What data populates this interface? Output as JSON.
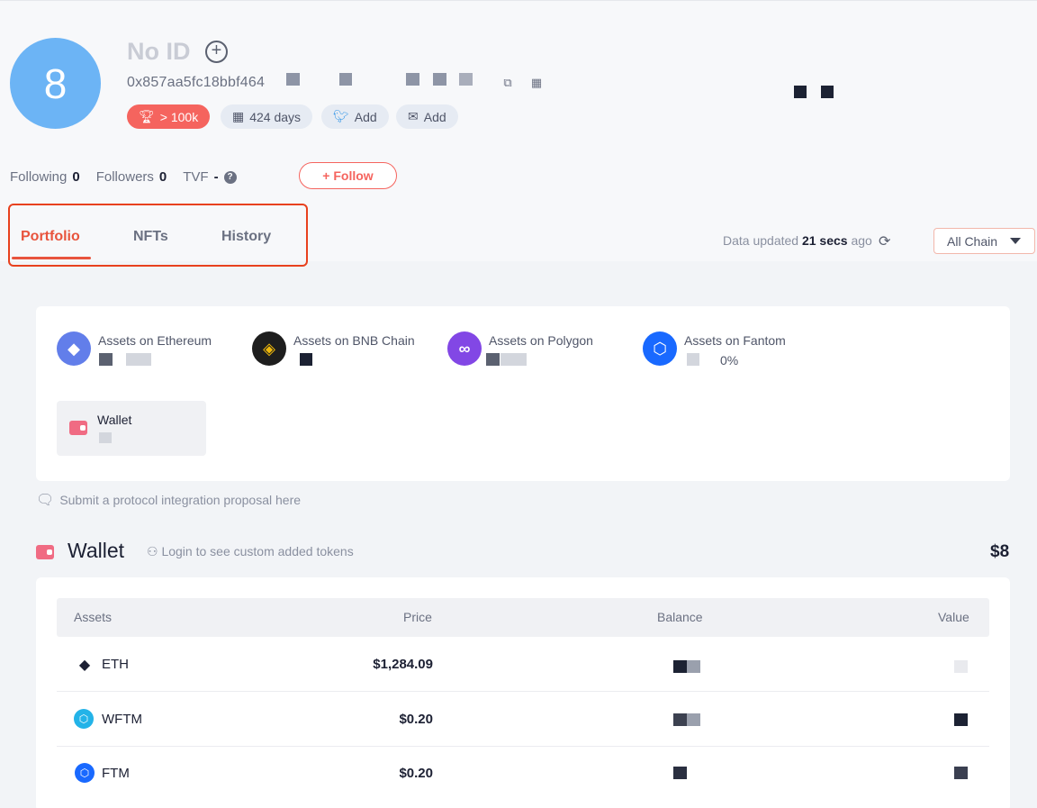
{
  "profile": {
    "avatar_text": "8",
    "name": "No ID",
    "address": "0x857aa5fc18bbf464",
    "badges": {
      "rank": "> 100k",
      "age": "424 days",
      "twitter": "Add",
      "email": "Add"
    },
    "following_label": "Following",
    "following_count": "0",
    "followers_label": "Followers",
    "followers_count": "0",
    "tvf_label": "TVF",
    "tvf_value": "-",
    "follow_button": "+ Follow"
  },
  "tabs": [
    {
      "label": "Portfolio",
      "active": true
    },
    {
      "label": "NFTs",
      "active": false
    },
    {
      "label": "History",
      "active": false
    }
  ],
  "update_status": {
    "prefix": "Data updated",
    "time": "21 secs",
    "suffix": "ago"
  },
  "chain_filter": {
    "selected": "All Chain"
  },
  "chains": [
    {
      "label": "Assets on Ethereum",
      "color": "#627eea",
      "icon": "ethereum-icon"
    },
    {
      "label": "Assets on BNB Chain",
      "color": "#1e1e1e",
      "icon": "bnb-icon"
    },
    {
      "label": "Assets on Polygon",
      "color": "#8247e5",
      "icon": "polygon-icon"
    },
    {
      "label": "Assets on Fantom",
      "color": "#1969ff",
      "icon": "fantom-icon",
      "percent": "0%"
    }
  ],
  "wallet_tile": {
    "label": "Wallet"
  },
  "proposal_link": "Submit a protocol integration proposal here",
  "wallet_section": {
    "title": "Wallet",
    "login_note": "Login to see custom added tokens",
    "total": "$8"
  },
  "table": {
    "headers": {
      "assets": "Assets",
      "price": "Price",
      "balance": "Balance",
      "value": "Value"
    },
    "rows": [
      {
        "asset": "ETH",
        "price": "$1,284.09",
        "icon": "eth-token-icon"
      },
      {
        "asset": "WFTM",
        "price": "$0.20",
        "icon": "wftm-token-icon"
      },
      {
        "asset": "FTM",
        "price": "$0.20",
        "icon": "ftm-token-icon"
      }
    ]
  }
}
